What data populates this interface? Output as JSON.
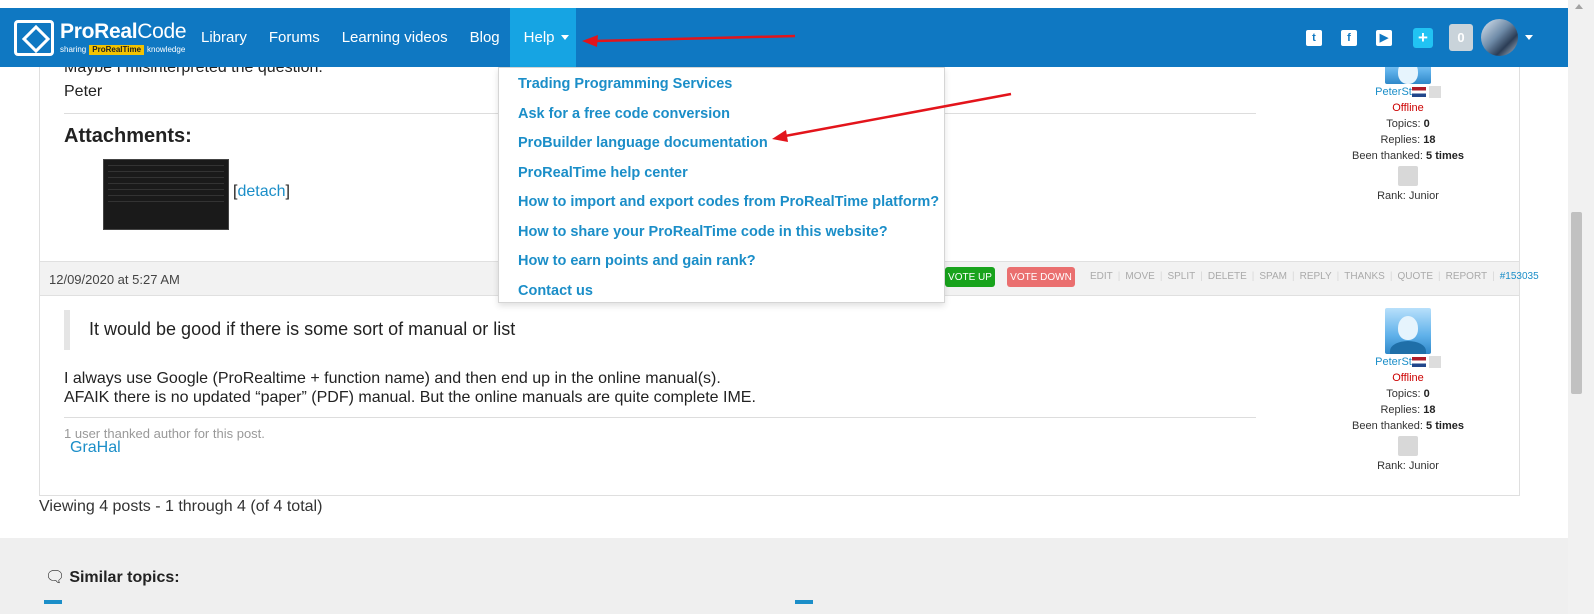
{
  "navbar": {
    "logo": {
      "title_bold": "ProReal",
      "title_thin": "Code",
      "sub_left": "sharing",
      "sub_highlight": "ProRealTime",
      "sub_right": "knowledge"
    },
    "links": [
      {
        "label": "Library"
      },
      {
        "label": "Forums"
      },
      {
        "label": "Learning videos"
      },
      {
        "label": "Blog"
      },
      {
        "label": "Help"
      }
    ],
    "social_icons": [
      "twitter-icon",
      "facebook-icon",
      "youtube-icon"
    ],
    "notification_count": "0"
  },
  "help_menu": {
    "items": [
      "Trading Programming Services",
      "Ask for a free code conversion",
      "ProBuilder language documentation",
      "ProRealTime help center",
      "How to import and export codes from ProRealTime platform?",
      "How to share your ProRealTime code in this website?",
      "How to earn points and gain rank?",
      "Contact us"
    ]
  },
  "post1": {
    "clipped_line": "Maybe I misinterpreted the question.",
    "signature": "Peter",
    "attachments_heading": "Attachments:",
    "detach_open": "[",
    "detach_label": "detach",
    "detach_close": "]"
  },
  "post_meta": {
    "date": "12/09/2020 at 5:27 AM",
    "vote_up": "VOTE UP",
    "vote_down": "VOTE DOWN",
    "actions": [
      "EDIT",
      "MOVE",
      "SPLIT",
      "DELETE",
      "SPAM",
      "REPLY",
      "THANKS",
      "QUOTE",
      "REPORT"
    ],
    "post_id": "#153035"
  },
  "post2": {
    "quote": "It would be good if there is some sort of manual or list",
    "line1": "I always use Google (ProRealtime + function name) and then end up in the online manual(s).",
    "line2": "AFAIK there is no updated “paper” (PDF) manual. But the online manuals are quite complete IME.",
    "thanked": "1 user thanked author for this post.",
    "thanker": "GraHal"
  },
  "author": {
    "name": "PeterSt",
    "status": "Offline",
    "topics_label": "Topics: ",
    "topics": "0",
    "replies_label": "Replies: ",
    "replies": "18",
    "thanked_label": "Been thanked: ",
    "thanked": "5 times",
    "rank": "Rank: Junior"
  },
  "footer": {
    "viewing": "Viewing 4 posts - 1 through 4 (of 4 total)",
    "similar_heading": "Similar topics:"
  }
}
